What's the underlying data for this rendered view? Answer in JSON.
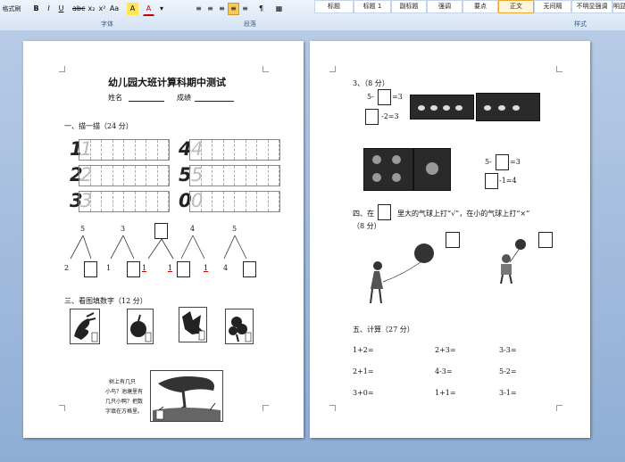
{
  "ribbon": {
    "format_painter": "格式刷",
    "format_buttons": [
      "B",
      "I",
      "U",
      "abc",
      "x₂",
      "x²",
      "Aa",
      "A",
      "A"
    ],
    "para_buttons": [
      "≡",
      "≡",
      "≡",
      "≡",
      "≡",
      "¶",
      "▦"
    ],
    "groups": {
      "font": "字体",
      "paragraph": "段落",
      "styles": "样式"
    },
    "styles": [
      "标题",
      "标题 1",
      "副标题",
      "强调",
      "要点",
      "正文",
      "无间隔",
      "不明显强调",
      "明显"
    ],
    "active_style": "正文"
  },
  "page1": {
    "title": "幼儿园大班计算科期中测试",
    "name_label": "姓名",
    "score_label": "成绩",
    "section1": "一、描一描（24 分）",
    "trace_digits": [
      "1",
      "4",
      "2",
      "5",
      "3",
      "0"
    ],
    "decomp": [
      {
        "top": "5",
        "left": "2"
      },
      {
        "top": "3",
        "left": "1"
      },
      {
        "top": "",
        "left": "1"
      },
      {
        "top": "4",
        "left": "1"
      },
      {
        "top": "5",
        "left": "4"
      }
    ],
    "section3": "三、看图填数字（12 分）",
    "note_text": [
      "树上有几只",
      "小鸟？池塘里有",
      "几只小鸭？把数",
      "字填在方格里。"
    ]
  },
  "page2": {
    "q3": "3、（8 分）",
    "eq1a": "5-",
    "eq1b": "=3",
    "eq2": "-2=3",
    "eq3a": "5-",
    "eq3b": "=3",
    "eq4": "-1=4",
    "section4_a": "四、在",
    "section4_b": "里大的气球上打“√”，在小的气球上打“×”",
    "section4_score": "（8 分）",
    "section5": "五、计算（27 分）",
    "calc": [
      [
        "1+2=",
        "2+3=",
        "3-3="
      ],
      [
        "2+1=",
        "4-3=",
        "5-2="
      ],
      [
        "3+0=",
        "1+1=",
        "3-1="
      ]
    ]
  },
  "colors": {
    "accent": "#3b5c8a",
    "ribbon_bg": "#dce7f5",
    "workspace": "#9fb8dc"
  }
}
